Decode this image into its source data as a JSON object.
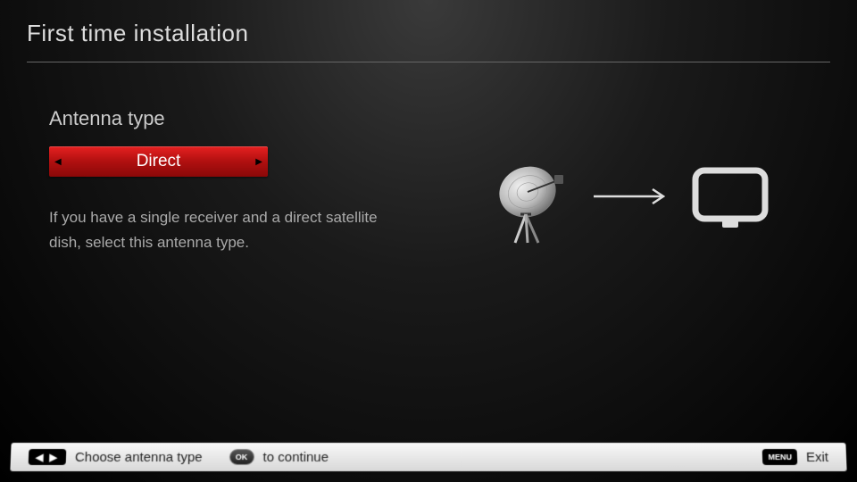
{
  "header": {
    "title": "First time installation"
  },
  "section": {
    "label": "Antenna type",
    "selected_value": "Direct",
    "description": "If you have a single receiver and a direct satellite dish, select this antenna type."
  },
  "footer": {
    "left_right_hint": "Choose antenna type",
    "ok_label": "OK",
    "ok_hint": "to continue",
    "menu_label": "MENU",
    "menu_hint": "Exit",
    "arrows_glyph": "◀ ▶"
  }
}
